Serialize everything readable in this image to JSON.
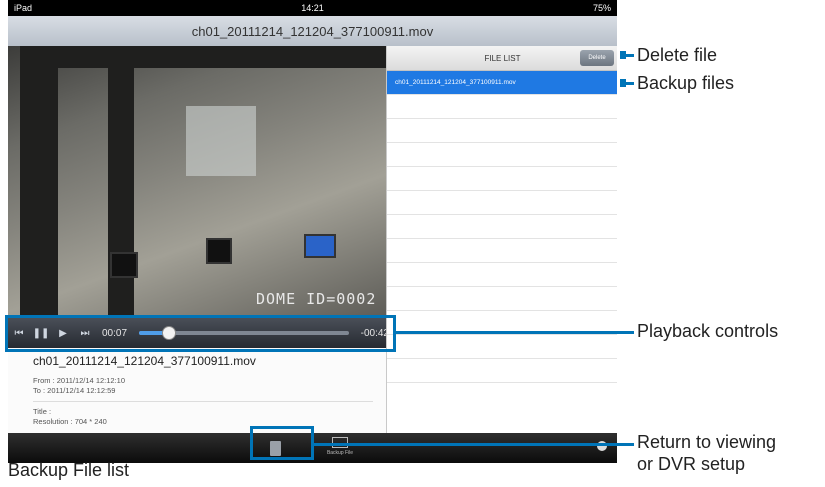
{
  "status": {
    "device": "iPad",
    "time": "14:21",
    "battery": "75%"
  },
  "window_title": "ch01_20111214_121204_377100911.mov",
  "video": {
    "osd_text": "DOME ID=0002"
  },
  "controls": {
    "elapsed": "00:07",
    "remaining": "-00:42",
    "progress": 0.14
  },
  "info": {
    "file_name": "ch01_20111214_121204_377100911.mov",
    "from": "From : 2011/12/14 12:12:10",
    "to": "To : 2011/12/14 12:12:59",
    "title": "Title :",
    "resolution": "Resolution : 704 * 240"
  },
  "file_list": {
    "header": "FILE LIST",
    "delete_label": "Delete",
    "items": [
      "ch01_20111214_121204_377100911.mov"
    ],
    "empty_rows": 12
  },
  "tabbar": {
    "backup_label": "Backup File"
  },
  "callouts": {
    "delete_file": "Delete file",
    "backup_files": "Backup files",
    "playback_controls": "Playback controls",
    "return_line1": "Return to viewing",
    "return_line2": "or DVR setup"
  },
  "caption": "Backup File list",
  "colors": {
    "accent": "#0074b7",
    "selection": "#1f79e3"
  }
}
